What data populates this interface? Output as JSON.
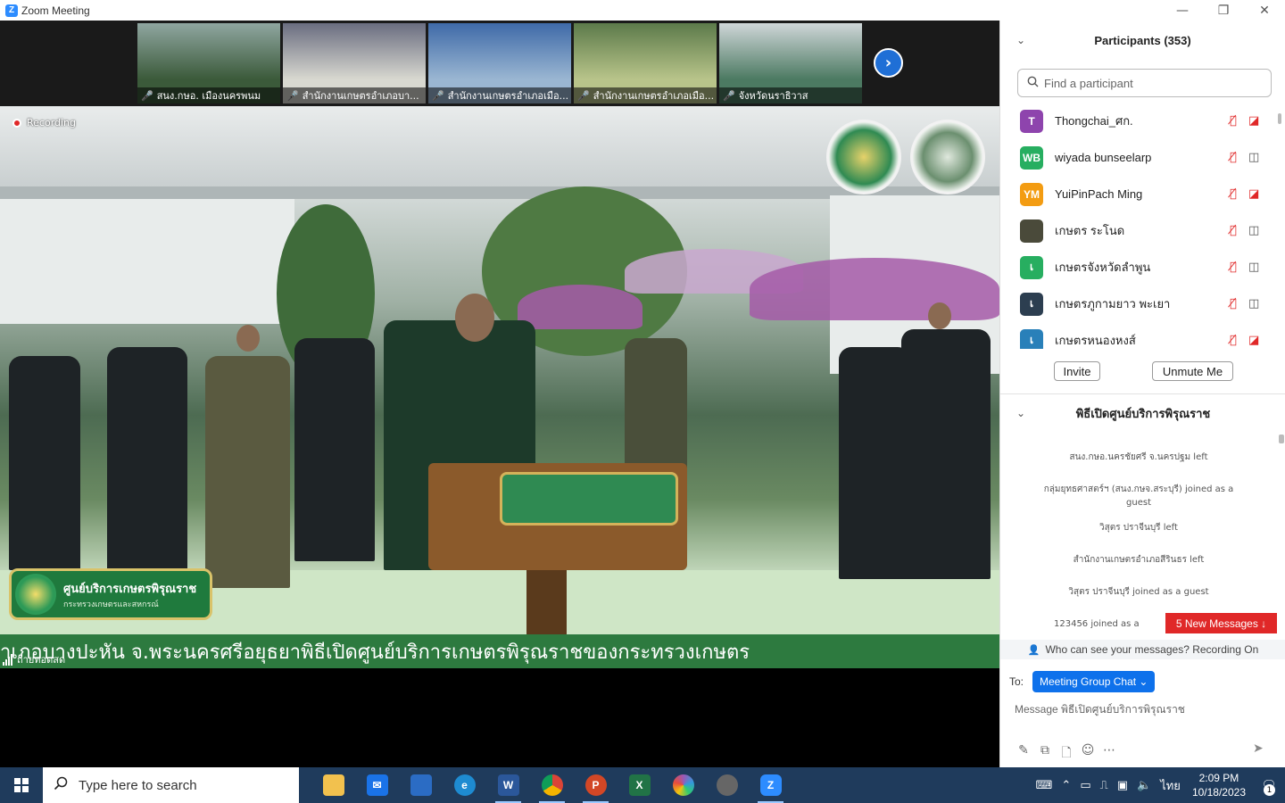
{
  "window": {
    "title": "Zoom Meeting",
    "minimize": "—",
    "restore": "❐",
    "close": "✕"
  },
  "thumbnails": [
    {
      "name": "สนง.กษอ. เมืองนครพนม",
      "colors": [
        "#3b5a3a",
        "#8fa6a0"
      ]
    },
    {
      "name": "สำนักงานเกษตรอำเภอบา...",
      "colors": [
        "#d8d8d0",
        "#6a6d80"
      ]
    },
    {
      "name": "สำนักงานเกษตรอำเภอเมือ...",
      "colors": [
        "#9ab6d2",
        "#3f6aa8"
      ]
    },
    {
      "name": "สำนักงานเกษตรอำเภอเมือ...",
      "colors": [
        "#b8c48a",
        "#5c7a4a"
      ]
    },
    {
      "name": "จังหวัดนราธิวาส",
      "colors": [
        "#4c7a62",
        "#cfd6d8"
      ]
    }
  ],
  "next_icon": "›",
  "recording": "Recording",
  "mic_muted_icon": "🎤",
  "video": {
    "logo_line1": "ศูนย์บริการเกษตรพิรุณราช",
    "logo_line2": "กระทรวงเกษตรและสหกรณ์",
    "ticker": "าเภอบางปะหัน จ.พระนครศรีอยุธยาพิธีเปิดศูนย์บริการเกษตรพิรุณราชของกระทรวงเกษตร",
    "live": "ถ่ายทอดสด"
  },
  "participants": {
    "title": "Participants (353)",
    "collapse_icon": "⌄",
    "search_placeholder": "Find a participant",
    "list": [
      {
        "initials": "T",
        "name": "Thongchai_ศก.",
        "color": "#8e44ad",
        "cam": "off"
      },
      {
        "initials": "WB",
        "name": "wiyada bunseelarp",
        "color": "#27ae60",
        "cam": "on"
      },
      {
        "initials": "YM",
        "name": "YuiPinPach Ming",
        "color": "#f39c12",
        "cam": "off"
      },
      {
        "initials": "",
        "name": "เกษตร ระโนด",
        "color": "#4a4a3a",
        "cam": "on"
      },
      {
        "initials": "เ",
        "name": "เกษตรจังหวัดลำพูน",
        "color": "#27ae60",
        "cam": "on"
      },
      {
        "initials": "เ",
        "name": "เกษตรภูกามยาว พะเยา",
        "color": "#2c3e50",
        "cam": "on"
      },
      {
        "initials": "เ",
        "name": "เกษตรหนองหงส์",
        "color": "#2980b9",
        "cam": "off"
      }
    ],
    "invite": "Invite",
    "unmute": "Unmute Me"
  },
  "chat": {
    "title": "พิธีเปิดศูนย์บริการพิรุณราช",
    "messages": [
      "สนง.กษอ.นครชัยศรี จ.นครปฐม left",
      "กลุ่มยุทธศาสตร์ฯ (สนง.กษจ.สระบุรี) joined as a guest",
      "วิสุตร ปราจีนบุรี left",
      "สำนักงานเกษตรอำเภอสีรินธร left",
      "วิสุตร ปราจีนบุรี joined as a guest",
      "123456 joined as a"
    ],
    "new_messages": "5 New Messages ↓",
    "who_can_see": "Who can see your messages? Recording On",
    "to_label": "To:",
    "to_value": "Meeting Group Chat ⌄",
    "message_placeholder": "Message พิธีเปิดศูนย์บริการพิรุณราช",
    "tools": [
      "✎",
      "⧉",
      "🗋",
      "☺",
      "⋯"
    ],
    "send_icon": "➤"
  },
  "taskbar": {
    "search_placeholder": "Type here to search",
    "apps": [
      {
        "name": "file-explorer",
        "label": "",
        "color": "#f2c14e"
      },
      {
        "name": "mail",
        "label": "✉",
        "color": "#1a73e8"
      },
      {
        "name": "store",
        "label": "",
        "color": "#2b6cc4"
      },
      {
        "name": "edge",
        "label": "e",
        "color": "#1e8bd1"
      },
      {
        "name": "word",
        "label": "W",
        "color": "#2b579a"
      },
      {
        "name": "chrome",
        "label": "",
        "color": "#db4437"
      },
      {
        "name": "powerpoint",
        "label": "P",
        "color": "#d24726"
      },
      {
        "name": "excel",
        "label": "X",
        "color": "#217346"
      },
      {
        "name": "paint",
        "label": "",
        "color": "#9b59b6"
      },
      {
        "name": "app-pro",
        "label": "",
        "color": "#555"
      },
      {
        "name": "zoom",
        "label": "Z",
        "color": "#2D8CFF"
      }
    ],
    "time": "2:09 PM",
    "date": "10/18/2023",
    "lang": "ไทย",
    "notification_count": "1"
  }
}
